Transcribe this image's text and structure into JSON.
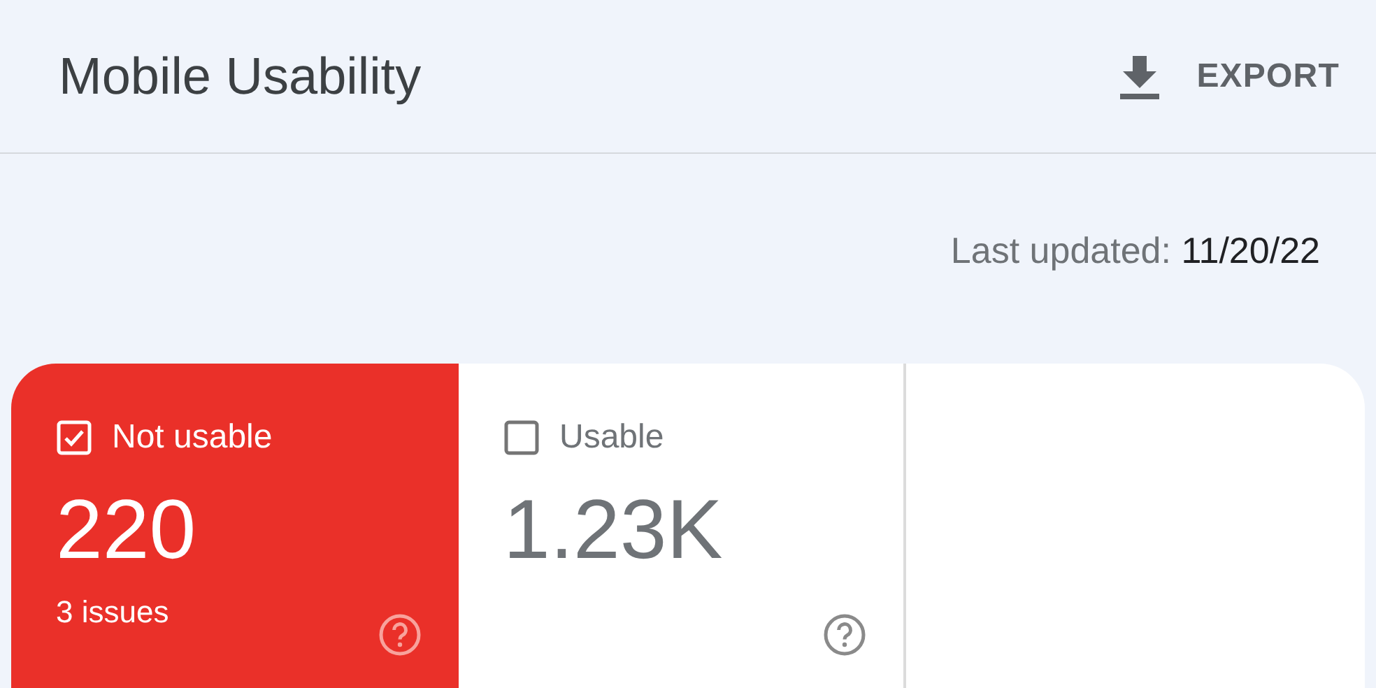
{
  "header": {
    "title": "Mobile Usability",
    "export_label": "EXPORT"
  },
  "last_updated": {
    "label": "Last updated:",
    "date": "11/20/22"
  },
  "tiles": [
    {
      "label": "Not usable",
      "value": "220",
      "sublabel": "3 issues",
      "selected": true
    },
    {
      "label": "Usable",
      "value": "1.23K",
      "selected": false
    }
  ]
}
